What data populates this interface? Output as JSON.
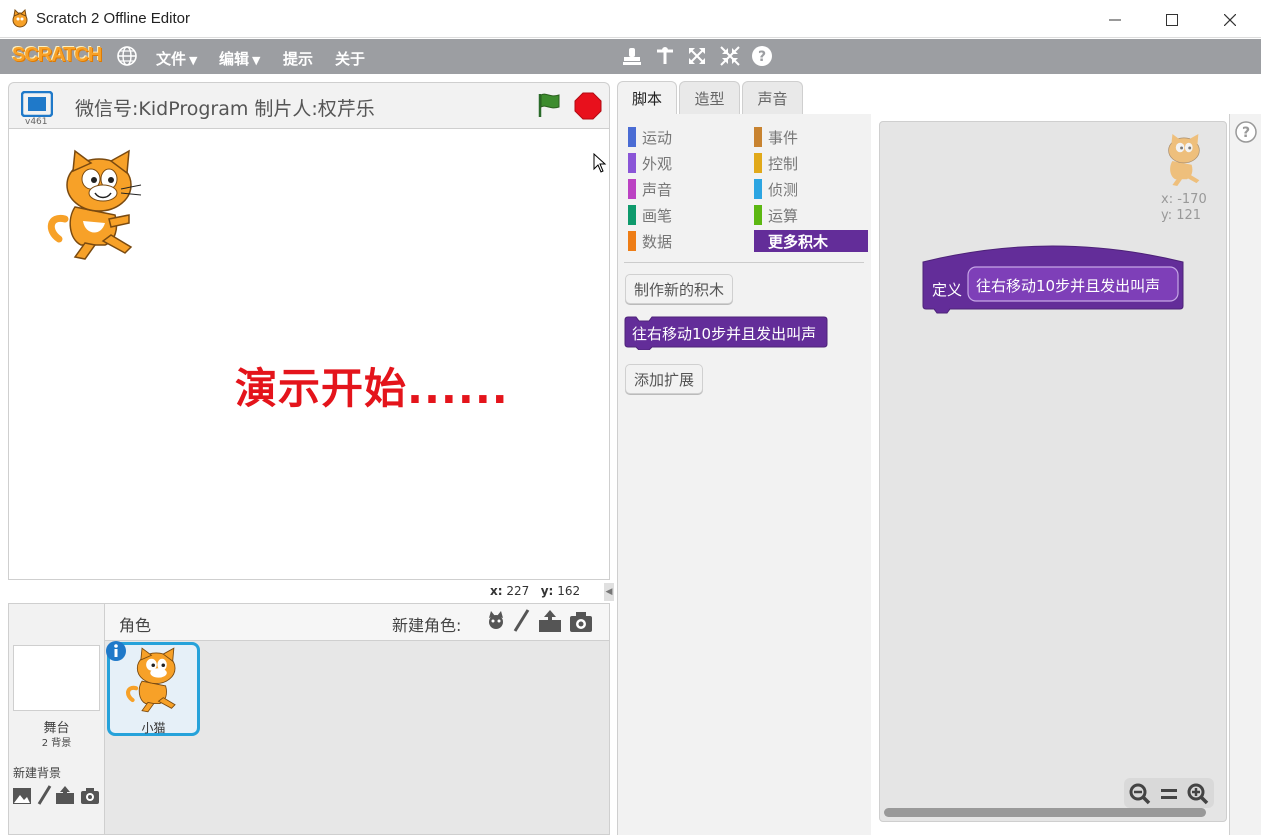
{
  "window": {
    "title": "Scratch 2 Offline Editor"
  },
  "menubar": {
    "logo": "SCRATCH",
    "items": [
      "文件",
      "编辑",
      "提示",
      "关于"
    ],
    "file_label": "文件",
    "edit_label": "编辑",
    "tips_label": "提示",
    "about_label": "关于"
  },
  "stage": {
    "title": "微信号:KidProgram 制片人:权芹乐",
    "version": "v461",
    "overlay_text": "演示开始......",
    "coords": {
      "x_label": "x:",
      "x_value": "227",
      "y_label": "y:",
      "y_value": "162"
    }
  },
  "sprites_pane": {
    "header": "角色",
    "new_sprite_label": "新建角色:",
    "stage_label": "舞台",
    "backdrops_count": "2 背景",
    "new_backdrop_label": "新建背景",
    "sprite_name": "小猫"
  },
  "tabs": [
    "脚本",
    "造型",
    "声音"
  ],
  "palette": {
    "categories_left": [
      {
        "label": "运动",
        "color": "#4a6cd4"
      },
      {
        "label": "外观",
        "color": "#8a55d7"
      },
      {
        "label": "声音",
        "color": "#bb42c3"
      },
      {
        "label": "画笔",
        "color": "#0e9a6c"
      },
      {
        "label": "数据",
        "color": "#ee7d16"
      }
    ],
    "categories_right": [
      {
        "label": "事件",
        "color": "#c88330"
      },
      {
        "label": "控制",
        "color": "#e1a91a"
      },
      {
        "label": "侦测",
        "color": "#2ca5e2"
      },
      {
        "label": "运算",
        "color": "#5cb712"
      },
      {
        "label": "更多积木",
        "color": "#632d99"
      }
    ],
    "make_block_label": "制作新的积木",
    "custom_block_label": "往右移动10步并且发出叫声",
    "add_extension_label": "添加扩展"
  },
  "scripts_area": {
    "sprite_x": "x: -170",
    "sprite_y": "y: 121",
    "define_label": "定义",
    "define_block_label": "往右移动10步并且发出叫声"
  },
  "colors": {
    "menubar": "#9c9ea2",
    "more_blocks": "#632d99",
    "overlay_text": "#e4141b",
    "selected_sprite_border": "#26a2da"
  }
}
